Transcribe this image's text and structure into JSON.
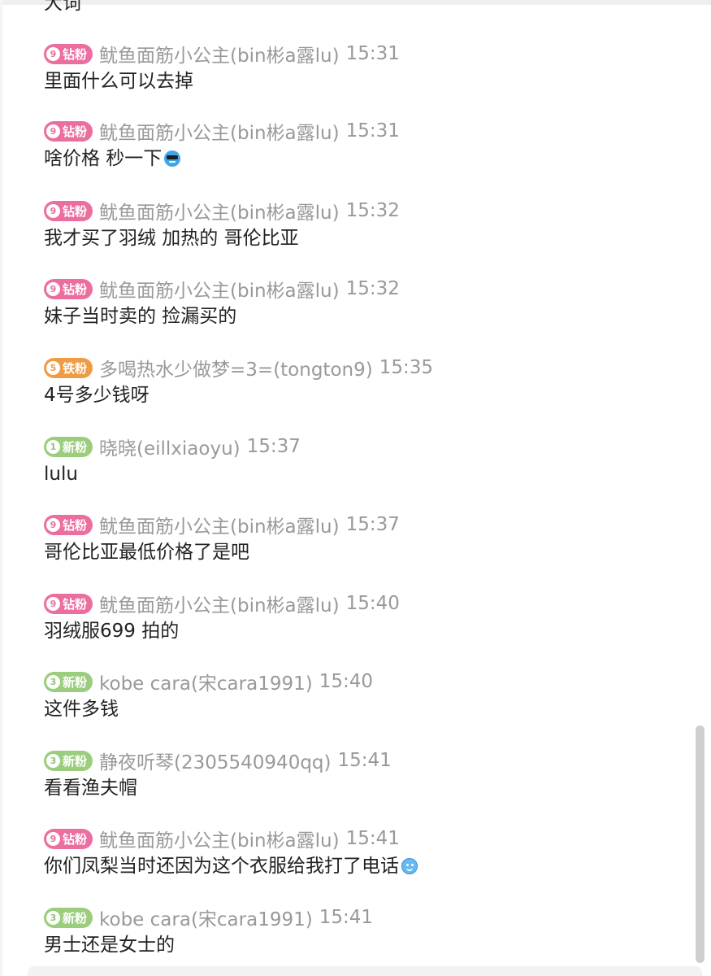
{
  "partial_message": "大词",
  "messages": [
    {
      "badge_level": "9",
      "badge_text": "钻粉",
      "badge_type": "diamond",
      "user": "鱿鱼面筋小公主(bin彬a露lu)",
      "time": "15:31",
      "text": "里面什么可以去掉",
      "emoji": ""
    },
    {
      "badge_level": "9",
      "badge_text": "钻粉",
      "badge_type": "diamond",
      "user": "鱿鱼面筋小公主(bin彬a露lu)",
      "time": "15:31",
      "text": "啥价格 秒一下",
      "emoji": "cool-sunglasses-icon"
    },
    {
      "badge_level": "9",
      "badge_text": "钻粉",
      "badge_type": "diamond",
      "user": "鱿鱼面筋小公主(bin彬a露lu)",
      "time": "15:32",
      "text": "我才买了羽绒 加热的 哥伦比亚",
      "emoji": ""
    },
    {
      "badge_level": "9",
      "badge_text": "钻粉",
      "badge_type": "diamond",
      "user": "鱿鱼面筋小公主(bin彬a露lu)",
      "time": "15:32",
      "text": "妹子当时卖的 捡漏买的",
      "emoji": ""
    },
    {
      "badge_level": "5",
      "badge_text": "铁粉",
      "badge_type": "iron",
      "user": "多喝热水少做梦=3=(tongton9)",
      "time": "15:35",
      "text": "4号多少钱呀",
      "emoji": ""
    },
    {
      "badge_level": "1",
      "badge_text": "新粉",
      "badge_type": "new",
      "user": "晓晓(eillxiaoyu)",
      "time": "15:37",
      "text": "lulu",
      "emoji": ""
    },
    {
      "badge_level": "9",
      "badge_text": "钻粉",
      "badge_type": "diamond",
      "user": "鱿鱼面筋小公主(bin彬a露lu)",
      "time": "15:37",
      "text": "哥伦比亚最低价格了是吧",
      "emoji": ""
    },
    {
      "badge_level": "9",
      "badge_text": "钻粉",
      "badge_type": "diamond",
      "user": "鱿鱼面筋小公主(bin彬a露lu)",
      "time": "15:40",
      "text": "羽绒服699 拍的",
      "emoji": ""
    },
    {
      "badge_level": "3",
      "badge_text": "新粉",
      "badge_type": "new",
      "user": "kobe cara(宋cara1991)",
      "time": "15:40",
      "text": "这件多钱",
      "emoji": ""
    },
    {
      "badge_level": "3",
      "badge_text": "新粉",
      "badge_type": "new",
      "user": "静夜听琴(2305540940qq)",
      "time": "15:41",
      "text": "看看渔夫帽",
      "emoji": ""
    },
    {
      "badge_level": "9",
      "badge_text": "钻粉",
      "badge_type": "diamond",
      "user": "鱿鱼面筋小公主(bin彬a露lu)",
      "time": "15:41",
      "text": "你们凤梨当时还因为这个衣服给我打了电话",
      "emoji": "smile-face-icon"
    },
    {
      "badge_level": "3",
      "badge_text": "新粉",
      "badge_type": "new",
      "user": "kobe cara(宋cara1991)",
      "time": "15:41",
      "text": "男士还是女士的",
      "emoji": ""
    }
  ]
}
